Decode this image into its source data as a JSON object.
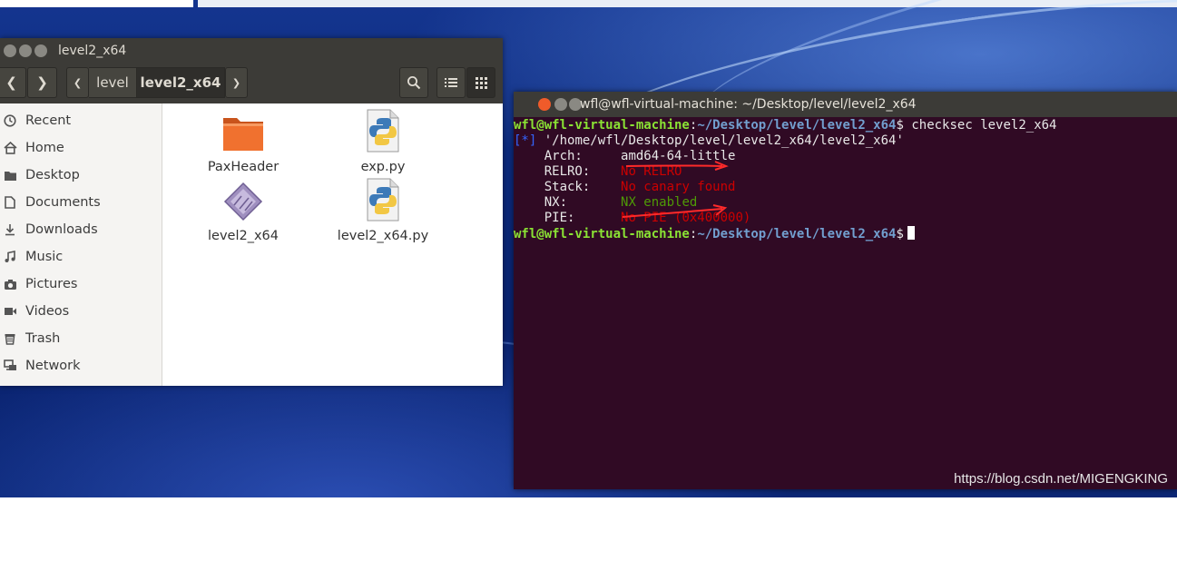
{
  "file_manager": {
    "title": "level2_x64",
    "breadcrumb": [
      "level",
      "level2_x64"
    ],
    "sidebar": [
      {
        "label": "Recent",
        "icon": "clock-icon"
      },
      {
        "label": "Home",
        "icon": "home-icon"
      },
      {
        "label": "Desktop",
        "icon": "desktop-folder-icon"
      },
      {
        "label": "Documents",
        "icon": "documents-icon"
      },
      {
        "label": "Downloads",
        "icon": "download-icon"
      },
      {
        "label": "Music",
        "icon": "music-icon"
      },
      {
        "label": "Pictures",
        "icon": "camera-icon"
      },
      {
        "label": "Videos",
        "icon": "video-icon"
      },
      {
        "label": "Trash",
        "icon": "trash-icon"
      },
      {
        "label": "Network",
        "icon": "network-icon"
      }
    ],
    "files": [
      {
        "name": "PaxHeader",
        "icon": "folder-icon"
      },
      {
        "name": "exp.py",
        "icon": "python-file-icon"
      },
      {
        "name": "level2_x64",
        "icon": "executable-icon"
      },
      {
        "name": "level2_x64.py",
        "icon": "python-file-icon"
      }
    ]
  },
  "terminal": {
    "title": "wfl@wfl-virtual-machine: ~/Desktop/level/level2_x64",
    "prompt_user": "wfl@wfl-virtual-machine",
    "prompt_sep": ":",
    "prompt_path": "~/Desktop/level/level2_x64",
    "prompt_dollar": "$",
    "command": " checksec level2_x64",
    "info_tag": "[*]",
    "info_path": " '/home/wfl/Desktop/level/level2_x64/level2_x64'",
    "rows": [
      {
        "key": "    Arch:     ",
        "value": "amd64-64-little",
        "color": "default"
      },
      {
        "key": "    RELRO:    ",
        "value": "No RELRO",
        "color": "red"
      },
      {
        "key": "    Stack:    ",
        "value": "No canary found",
        "color": "red"
      },
      {
        "key": "    NX:       ",
        "value": "NX enabled",
        "color": "green"
      },
      {
        "key": "    PIE:      ",
        "value": "No PIE (0x400000)",
        "color": "red"
      }
    ]
  },
  "watermark": "https://blog.csdn.net/MIGENGKING",
  "colors": {
    "terminal_bg": "#300a24",
    "titlebar": "#3c3b37",
    "close_button": "#f05b2a",
    "annotation_arrow": "#ff2a2a"
  }
}
